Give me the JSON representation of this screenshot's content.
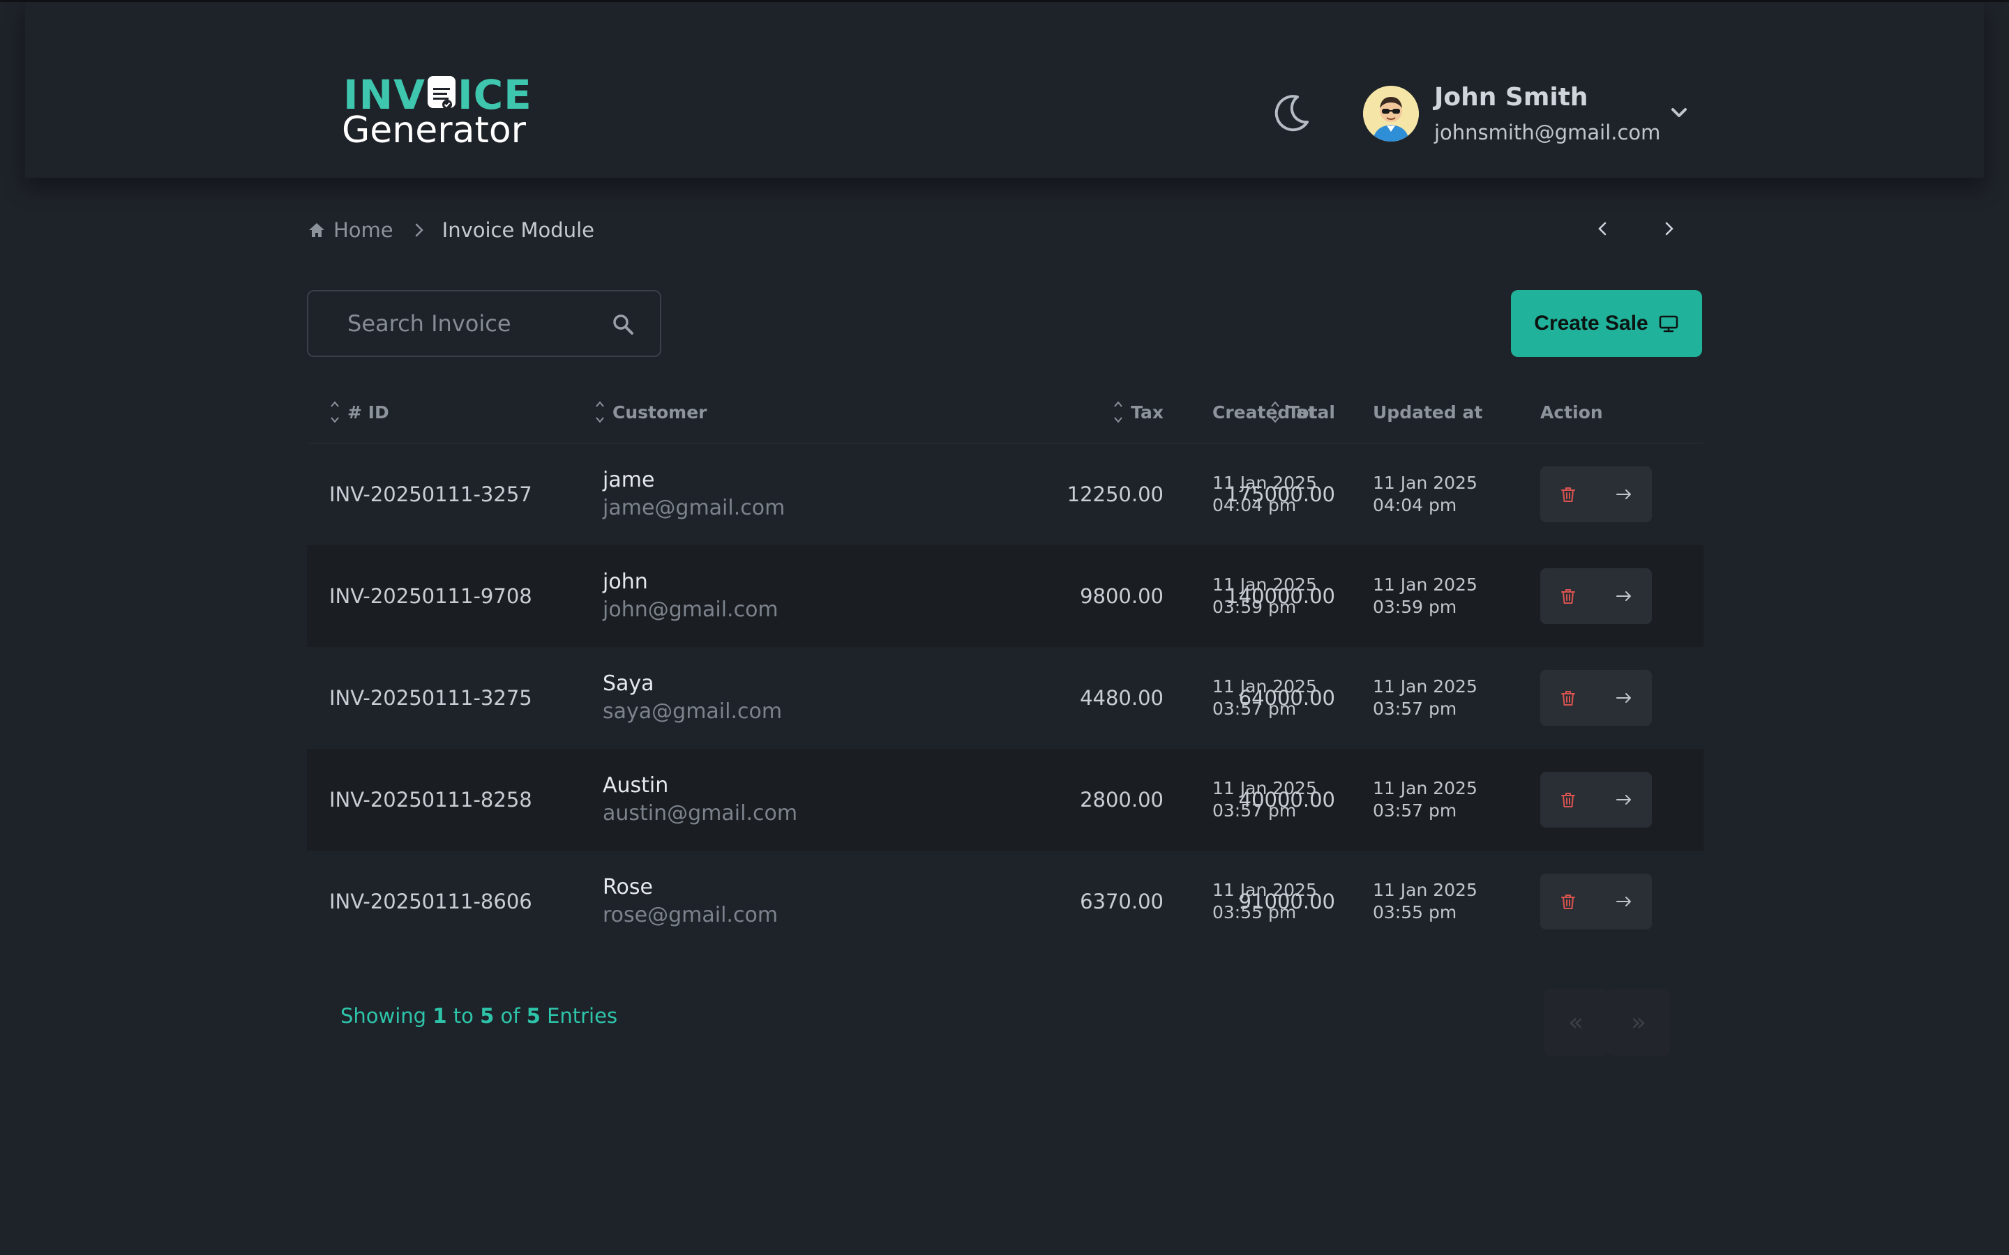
{
  "logo": {
    "line1_a": "INV",
    "line1_b": "ICE",
    "line2": "Generator",
    "icon": "invoice-document-icon"
  },
  "header": {
    "theme_icon": "moon-icon",
    "user": {
      "name": "John Smith",
      "email": "johnsmith@gmail.com",
      "avatar_icon": "avatar"
    }
  },
  "breadcrumb": {
    "home": "Home",
    "current": "Invoice Module"
  },
  "search": {
    "placeholder": "Search Invoice",
    "value": ""
  },
  "create_button": {
    "label": "Create Sale",
    "icon": "monitor-icon"
  },
  "table": {
    "columns": [
      "# ID",
      "Customer",
      "Tax",
      "Total",
      "Created at",
      "Updated at",
      "Action"
    ],
    "rows": [
      {
        "id": "INV-20250111-3257",
        "name": "jame",
        "email": "jame@gmail.com",
        "tax": "12250.00",
        "total": "175000.00",
        "created_date": "11 Jan 2025",
        "created_time": "04:04 pm",
        "updated_date": "11 Jan 2025",
        "updated_time": "04:04 pm"
      },
      {
        "id": "INV-20250111-9708",
        "name": "john",
        "email": "john@gmail.com",
        "tax": "9800.00",
        "total": "140000.00",
        "created_date": "11 Jan 2025",
        "created_time": "03:59 pm",
        "updated_date": "11 Jan 2025",
        "updated_time": "03:59 pm"
      },
      {
        "id": "INV-20250111-3275",
        "name": "Saya",
        "email": "saya@gmail.com",
        "tax": "4480.00",
        "total": "64000.00",
        "created_date": "11 Jan 2025",
        "created_time": "03:57 pm",
        "updated_date": "11 Jan 2025",
        "updated_time": "03:57 pm"
      },
      {
        "id": "INV-20250111-8258",
        "name": "Austin",
        "email": "austin@gmail.com",
        "tax": "2800.00",
        "total": "40000.00",
        "created_date": "11 Jan 2025",
        "created_time": "03:57 pm",
        "updated_date": "11 Jan 2025",
        "updated_time": "03:57 pm"
      },
      {
        "id": "INV-20250111-8606",
        "name": "Rose",
        "email": "rose@gmail.com",
        "tax": "6370.00",
        "total": "91000.00",
        "created_date": "11 Jan 2025",
        "created_time": "03:55 pm",
        "updated_date": "11 Jan 2025",
        "updated_time": "03:55 pm"
      }
    ],
    "row_actions": {
      "delete_icon": "trash-icon",
      "open_icon": "arrow-right-icon"
    }
  },
  "footer": {
    "showing_prefix": "Showing",
    "from": "1",
    "to_word": "to",
    "to": "5",
    "of_word": "of",
    "total": "5",
    "suffix": "Entries",
    "prev_page": "«",
    "next_page": "»"
  },
  "colors": {
    "background": "#1e2229",
    "accent": "#21b29b",
    "danger": "#d9534f",
    "muted_text": "#8e949c"
  }
}
